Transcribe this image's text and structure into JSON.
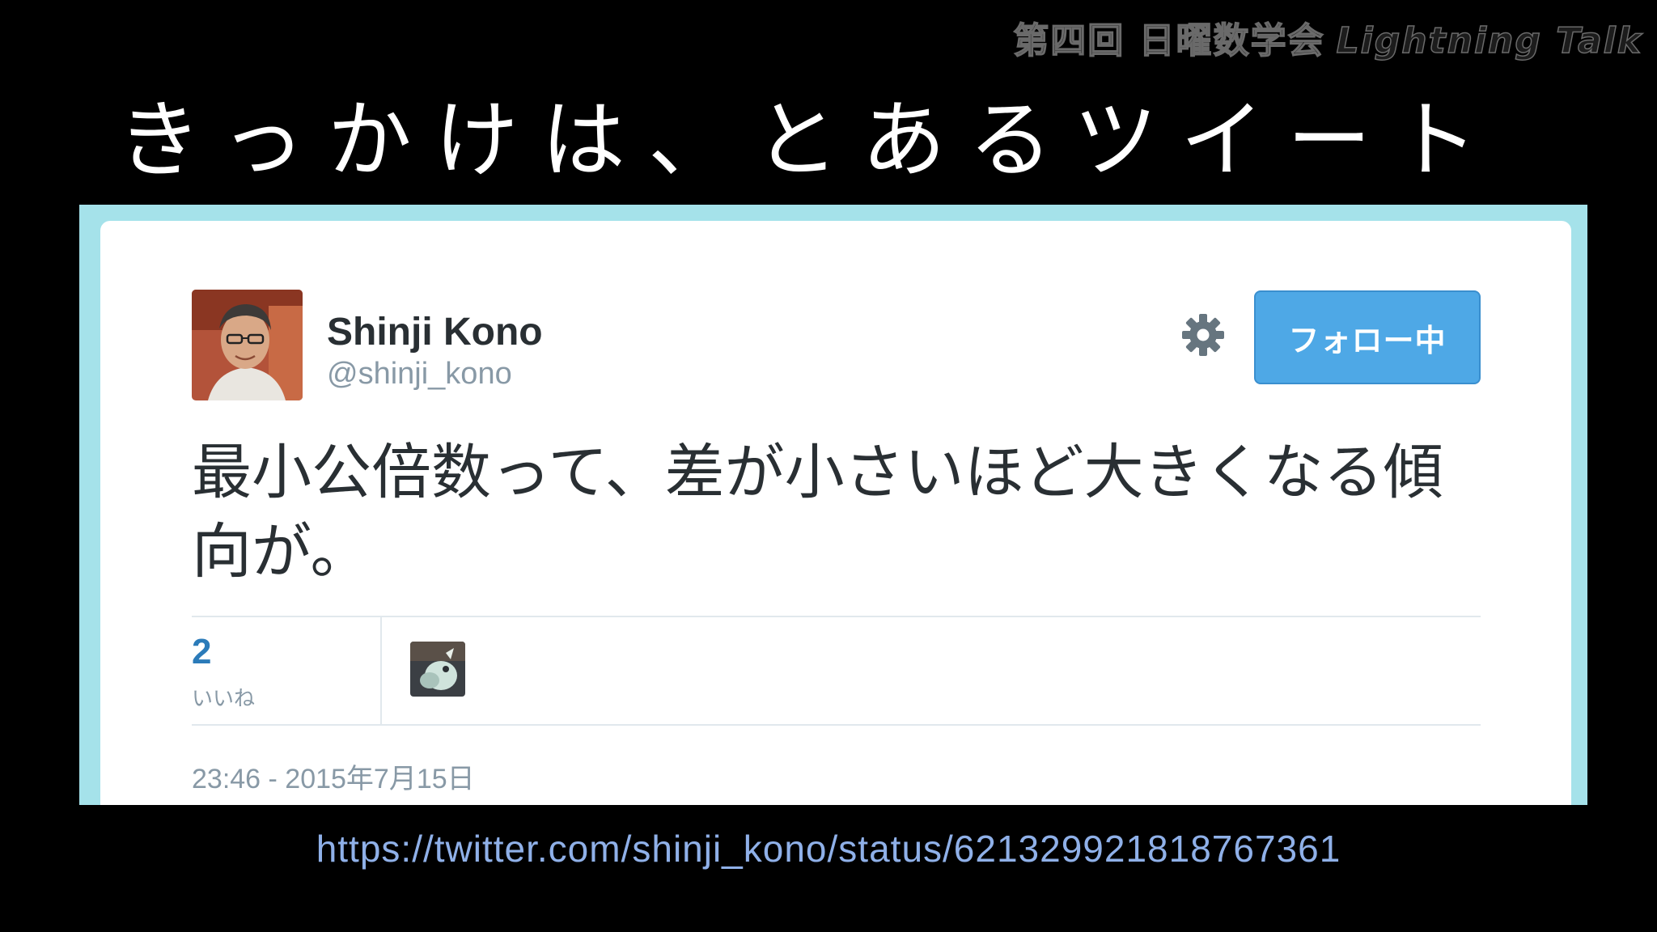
{
  "header": {
    "event": "第四回 日曜数学会",
    "talk_type": "Lightning Talk"
  },
  "slide": {
    "title": "きっかけは、とあるツイート"
  },
  "tweet": {
    "display_name": "Shinji Kono",
    "handle": "@shinji_kono",
    "follow_button": "フォロー中",
    "gear_icon": "gear-icon",
    "text": "最小公倍数って、差が小さいほど大きくなる傾向が。",
    "likes": {
      "count": "2",
      "label": "いいね"
    },
    "timestamp": "23:46 - 2015年7月15日"
  },
  "source": {
    "url": "https://twitter.com/shinji_kono/status/621329921818767361"
  },
  "colors": {
    "background": "#000000",
    "frame": "#a5e2ea",
    "follow_button": "#4ea8e6",
    "link": "#8fb0e8",
    "likes_count": "#2b7bb9",
    "muted_text": "#8899a6"
  }
}
